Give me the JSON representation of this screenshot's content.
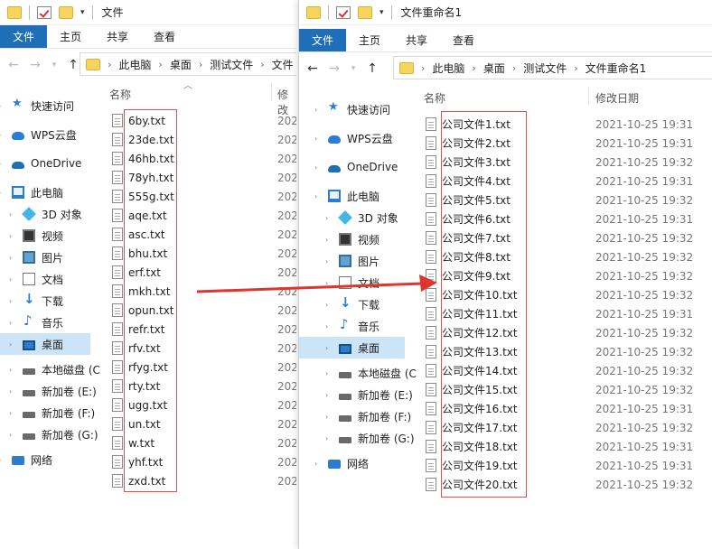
{
  "left_window": {
    "title": "文件",
    "ribbon_tabs": [
      "文件",
      "主页",
      "共享",
      "查看"
    ],
    "breadcrumbs": [
      "此电脑",
      "桌面",
      "测试文件",
      "文件"
    ],
    "columns": {
      "name": "名称",
      "date": "修改"
    },
    "nav": [
      {
        "label": "快速访问",
        "icon": "pin-icon"
      },
      {
        "label": "WPS云盘",
        "icon": "cloud-icon"
      },
      {
        "label": "OneDrive",
        "icon": "onedrive-icon"
      },
      {
        "label": "此电脑",
        "icon": "pc-icon"
      },
      {
        "label": "3D 对象",
        "icon": "cube-icon"
      },
      {
        "label": "视频",
        "icon": "video-icon"
      },
      {
        "label": "图片",
        "icon": "image-icon"
      },
      {
        "label": "文档",
        "icon": "doc-icon"
      },
      {
        "label": "下载",
        "icon": "down-icon"
      },
      {
        "label": "音乐",
        "icon": "music-icon"
      },
      {
        "label": "桌面",
        "icon": "desktop-icon",
        "selected": true
      },
      {
        "label": "本地磁盘 (C",
        "icon": "disk-icon"
      },
      {
        "label": "新加卷 (E:)",
        "icon": "disk-icon"
      },
      {
        "label": "新加卷 (F:)",
        "icon": "disk-icon"
      },
      {
        "label": "新加卷 (G:)",
        "icon": "disk-icon"
      },
      {
        "label": "网络",
        "icon": "network-icon"
      }
    ],
    "files": [
      "6by.txt",
      "23de.txt",
      "46hb.txt",
      "78yh.txt",
      "555g.txt",
      "aqe.txt",
      "asc.txt",
      "bhu.txt",
      "erf.txt",
      "mkh.txt",
      "opun.txt",
      "refr.txt",
      "rfv.txt",
      "rfyg.txt",
      "rty.txt",
      "ugg.txt",
      "un.txt",
      "w.txt",
      "yhf.txt",
      "zxd.txt"
    ],
    "date_prefix": "202"
  },
  "right_window": {
    "title": "文件重命名1",
    "ribbon_tabs": [
      "文件",
      "主页",
      "共享",
      "查看"
    ],
    "breadcrumbs": [
      "此电脑",
      "桌面",
      "测试文件",
      "文件重命名1"
    ],
    "columns": {
      "name": "名称",
      "date": "修改日期"
    },
    "nav": [
      {
        "label": "快速访问",
        "icon": "pin-icon"
      },
      {
        "label": "WPS云盘",
        "icon": "cloud-icon"
      },
      {
        "label": "OneDrive",
        "icon": "onedrive-icon"
      },
      {
        "label": "此电脑",
        "icon": "pc-icon"
      },
      {
        "label": "3D 对象",
        "icon": "cube-icon"
      },
      {
        "label": "视频",
        "icon": "video-icon"
      },
      {
        "label": "图片",
        "icon": "image-icon"
      },
      {
        "label": "文档",
        "icon": "doc-icon"
      },
      {
        "label": "下载",
        "icon": "down-icon"
      },
      {
        "label": "音乐",
        "icon": "music-icon"
      },
      {
        "label": "桌面",
        "icon": "desktop-icon",
        "selected": true
      },
      {
        "label": "本地磁盘 (C",
        "icon": "disk-icon"
      },
      {
        "label": "新加卷 (E:)",
        "icon": "disk-icon"
      },
      {
        "label": "新加卷 (F:)",
        "icon": "disk-icon"
      },
      {
        "label": "新加卷 (G:)",
        "icon": "disk-icon"
      },
      {
        "label": "网络",
        "icon": "network-icon"
      }
    ],
    "files": [
      {
        "name": "公司文件1.txt",
        "date": "2021-10-25 19:31"
      },
      {
        "name": "公司文件2.txt",
        "date": "2021-10-25 19:31"
      },
      {
        "name": "公司文件3.txt",
        "date": "2021-10-25 19:32"
      },
      {
        "name": "公司文件4.txt",
        "date": "2021-10-25 19:31"
      },
      {
        "name": "公司文件5.txt",
        "date": "2021-10-25 19:32"
      },
      {
        "name": "公司文件6.txt",
        "date": "2021-10-25 19:31"
      },
      {
        "name": "公司文件7.txt",
        "date": "2021-10-25 19:32"
      },
      {
        "name": "公司文件8.txt",
        "date": "2021-10-25 19:32"
      },
      {
        "name": "公司文件9.txt",
        "date": "2021-10-25 19:32"
      },
      {
        "name": "公司文件10.txt",
        "date": "2021-10-25 19:32"
      },
      {
        "name": "公司文件11.txt",
        "date": "2021-10-25 19:31"
      },
      {
        "name": "公司文件12.txt",
        "date": "2021-10-25 19:32"
      },
      {
        "name": "公司文件13.txt",
        "date": "2021-10-25 19:32"
      },
      {
        "name": "公司文件14.txt",
        "date": "2021-10-25 19:32"
      },
      {
        "name": "公司文件15.txt",
        "date": "2021-10-25 19:32"
      },
      {
        "name": "公司文件16.txt",
        "date": "2021-10-25 19:31"
      },
      {
        "name": "公司文件17.txt",
        "date": "2021-10-25 19:32"
      },
      {
        "name": "公司文件18.txt",
        "date": "2021-10-25 19:31"
      },
      {
        "name": "公司文件19.txt",
        "date": "2021-10-25 19:31"
      },
      {
        "name": "公司文件20.txt",
        "date": "2021-10-25 19:32"
      }
    ]
  },
  "colors": {
    "file_tab": "#1e6fb8",
    "selected_nav": "#cce4f7",
    "highlight_box": "#d9534f",
    "arrow": "#e0342f"
  }
}
